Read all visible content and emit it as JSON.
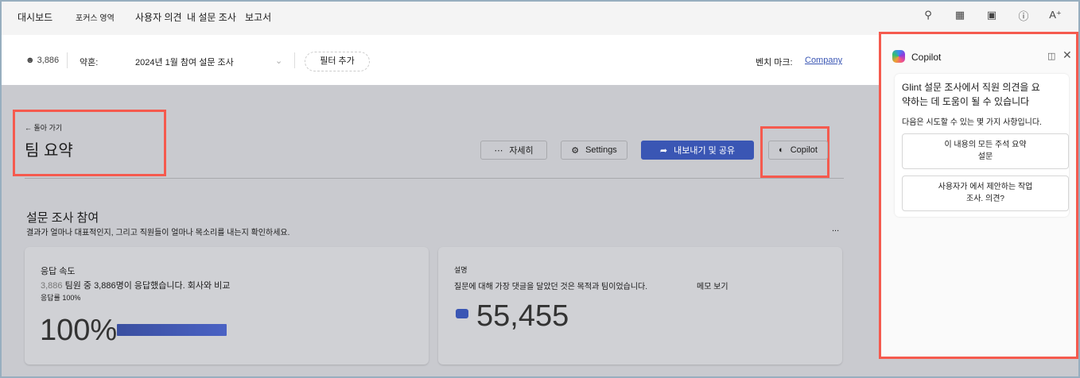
{
  "nav": {
    "items": [
      "대시보드",
      "포커스 영역",
      "사용자 의견",
      "내 설문 조사",
      "보고서"
    ]
  },
  "filter": {
    "count": "3,886",
    "survey_label": "약혼:",
    "survey_value": "2024년 1월 참여 설문 조사",
    "add_filter": "필터 추가",
    "benchmark_label": "벤치 마크:",
    "benchmark_value": "Company"
  },
  "header": {
    "back": "돌아 가기",
    "title": "팀 요약",
    "more": "자세히",
    "settings": "Settings",
    "export": "내보내기 및 공유",
    "copilot": "Copilot"
  },
  "section": {
    "title": "설문 조사 참여",
    "subtitle": "결과가 얼마나 대표적인지, 그리고 직원들이 얼마나 목소리를 내는지 확인하세요.",
    "menu": "..."
  },
  "response_card": {
    "title": "응답 속도",
    "count": "3,886",
    "line1": "팀원 중 3,886명이 응답했습니다. 회사와 비교",
    "line2": "응답률 100%",
    "value": "100%",
    "progress": 100,
    "bar_color": "#4a62c4"
  },
  "comments_card": {
    "title": "설명",
    "line1": "질문에 대해 가장 댓글을 달았던 것은 목적과 팀이었습니다.",
    "link": "메모 보기",
    "value": "55,455"
  },
  "copilot": {
    "title": "Copilot",
    "intro": "Glint 설문 조사에서 직원 의견을 요약하는 데 도움이 될 수 있습니다",
    "prompt": "다음은 시도할 수 있는 몇 가지 사항입니다.",
    "suggestions": [
      {
        "line1": "이 내용의 모든 주석 요약",
        "line2": "설문"
      },
      {
        "line1": "사용자가 에서 제안하는 작업",
        "line2": "조사. 의견?"
      }
    ]
  }
}
